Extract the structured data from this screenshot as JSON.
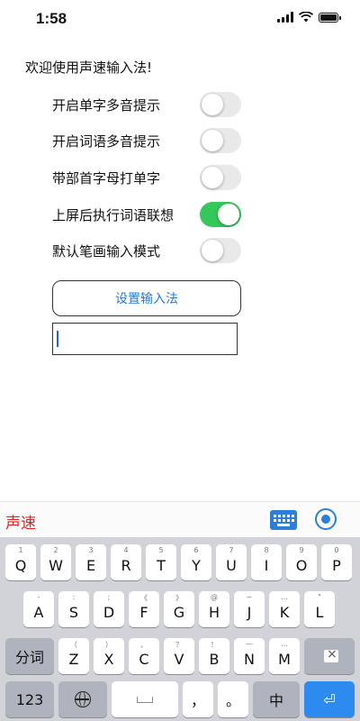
{
  "status": {
    "time": "1:58"
  },
  "welcome": "欢迎使用声速输入法!",
  "settings": [
    {
      "label": "开启单字多音提示",
      "on": false
    },
    {
      "label": "开启词语多音提示",
      "on": false
    },
    {
      "label": "带部首字母打单字",
      "on": false
    },
    {
      "label": "上屏后执行词语联想",
      "on": true
    },
    {
      "label": "默认笔画输入模式",
      "on": false
    }
  ],
  "setup_button": "设置输入法",
  "text_field": {
    "value": ""
  },
  "candidate_bar": {
    "brand": "声速"
  },
  "keyboard": {
    "row1": [
      {
        "main": "Q",
        "sub": "1"
      },
      {
        "main": "W",
        "sub": "2"
      },
      {
        "main": "E",
        "sub": "3"
      },
      {
        "main": "R",
        "sub": "4"
      },
      {
        "main": "T",
        "sub": "5"
      },
      {
        "main": "Y",
        "sub": "6"
      },
      {
        "main": "U",
        "sub": "7"
      },
      {
        "main": "I",
        "sub": "8"
      },
      {
        "main": "O",
        "sub": "9"
      },
      {
        "main": "P",
        "sub": "0"
      }
    ],
    "row2": [
      {
        "main": "A",
        "sub": "-"
      },
      {
        "main": "S",
        "sub": ":"
      },
      {
        "main": "D",
        "sub": ";"
      },
      {
        "main": "F",
        "sub": "《"
      },
      {
        "main": "G",
        "sub": "》"
      },
      {
        "main": "H",
        "sub": "@"
      },
      {
        "main": "J",
        "sub": "~"
      },
      {
        "main": "K",
        "sub": "…"
      },
      {
        "main": "L",
        "sub": "\""
      }
    ],
    "row3": [
      {
        "main": "Z",
        "sub": "（"
      },
      {
        "main": "X",
        "sub": "）"
      },
      {
        "main": "C",
        "sub": "、"
      },
      {
        "main": "V",
        "sub": "？"
      },
      {
        "main": "B",
        "sub": "！"
      },
      {
        "main": "N",
        "sub": "—"
      },
      {
        "main": "M",
        "sub": "…"
      }
    ],
    "fenci": "分词",
    "num": "123",
    "comma": "，",
    "period": "。",
    "zh": "中"
  }
}
